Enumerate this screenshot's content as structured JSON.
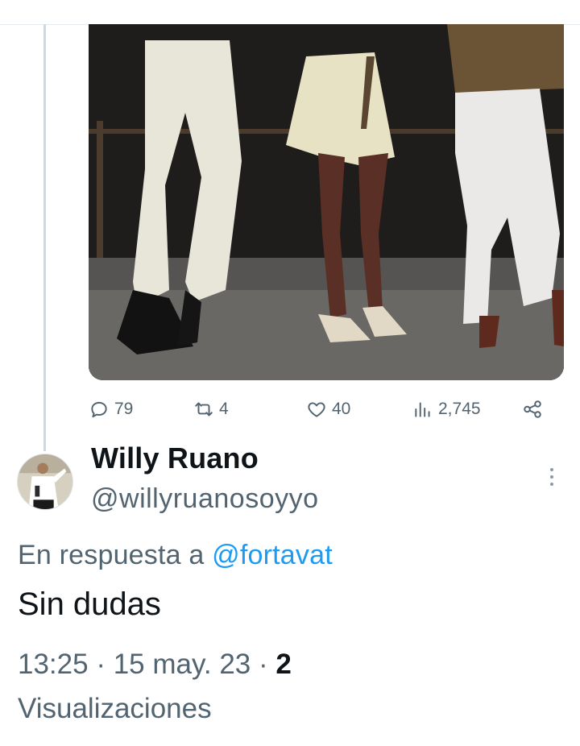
{
  "tweet_actions": {
    "replies": "79",
    "retweets": "4",
    "likes": "40",
    "views": "2,745"
  },
  "reply": {
    "author_name": "Willy Ruano",
    "author_handle": "@willyruanosoyyo",
    "reply_prefix": "En respuesta a",
    "reply_mention": "@fortavat",
    "text": "Sin dudas",
    "time": "13:25",
    "separator": "·",
    "date": "15 may. 23",
    "views_count": "2",
    "views_label": "Visualizaciones"
  },
  "colors": {
    "text_primary": "#0f1419",
    "text_secondary": "#536471",
    "link": "#1d9bf0",
    "thread_line": "#cfd9de"
  },
  "icons": [
    "reply-icon",
    "retweet-icon",
    "heart-icon",
    "views-icon",
    "share-icon",
    "more-icon"
  ]
}
